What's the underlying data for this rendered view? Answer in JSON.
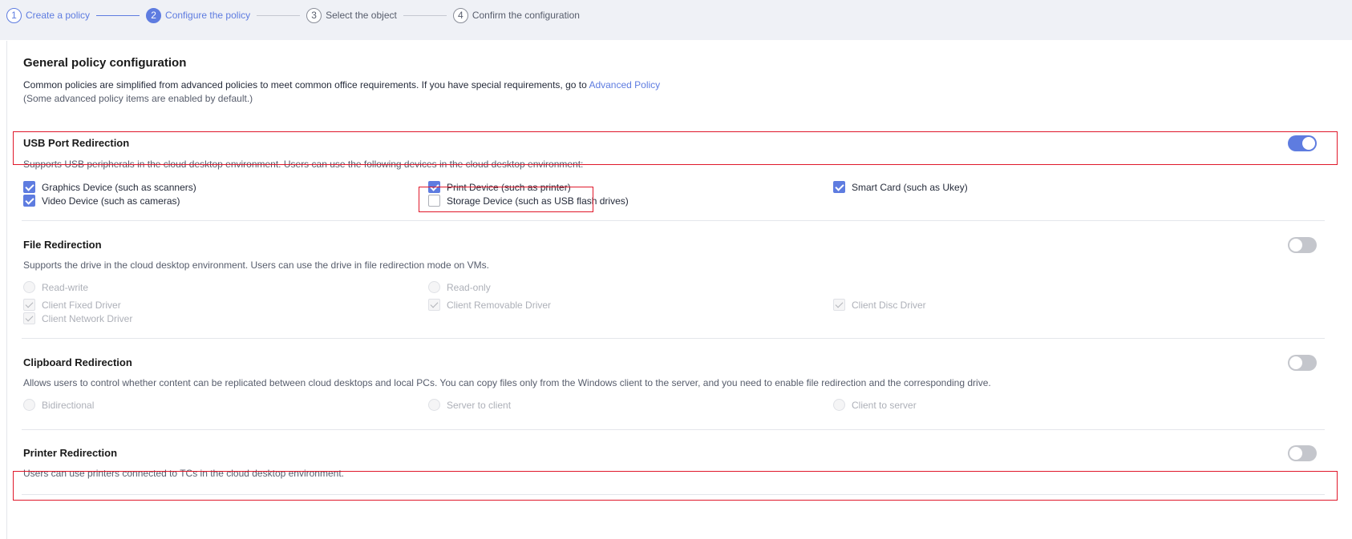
{
  "steps": [
    {
      "num": "1",
      "label": "Create a policy",
      "state": "done"
    },
    {
      "num": "2",
      "label": "Configure the policy",
      "state": "active"
    },
    {
      "num": "3",
      "label": "Select the object",
      "state": "todo"
    },
    {
      "num": "4",
      "label": "Confirm the configuration",
      "state": "todo"
    }
  ],
  "page": {
    "title": "General policy configuration",
    "desc_prefix": "Common policies are simplified from advanced policies to meet common office requirements. If you have special requirements, go to",
    "desc_link": "Advanced Policy",
    "note": "(Some advanced policy items are enabled by default.)"
  },
  "usb": {
    "title": "USB Port Redirection",
    "enabled": true,
    "desc": "Supports USB peripherals in the cloud desktop environment. Users can use the following devices in the cloud desktop environment:",
    "options": [
      {
        "label": "Graphics Device (such as scanners)",
        "checked": true
      },
      {
        "label": "Print Device (such as printer)",
        "checked": true
      },
      {
        "label": "Smart Card (such as Ukey)",
        "checked": true
      },
      {
        "label": "Video Device (such as cameras)",
        "checked": true
      },
      {
        "label": "Storage Device (such as USB flash drives)",
        "checked": false
      }
    ]
  },
  "file": {
    "title": "File Redirection",
    "enabled": false,
    "desc": "Supports the drive in the cloud desktop environment. Users can use the drive in file redirection mode on VMs.",
    "modes": [
      "Read-write",
      "Read-only"
    ],
    "drivers": [
      "Client Fixed Driver",
      "Client Removable Driver",
      "Client Disc Driver",
      "Client Network Driver"
    ]
  },
  "clipboard": {
    "title": "Clipboard Redirection",
    "enabled": false,
    "desc": "Allows users to control whether content can be replicated between cloud desktops and local PCs. You can copy files only from the Windows client to the server, and you need to enable file redirection and the corresponding drive.",
    "modes": [
      "Bidirectional",
      "Server to client",
      "Client to server"
    ]
  },
  "printer": {
    "title": "Printer Redirection",
    "enabled": false,
    "desc": "Users can use printers connected to TCs in the cloud desktop environment."
  },
  "colors": {
    "accent": "#5e7ce0",
    "highlight": "#e0182a"
  }
}
